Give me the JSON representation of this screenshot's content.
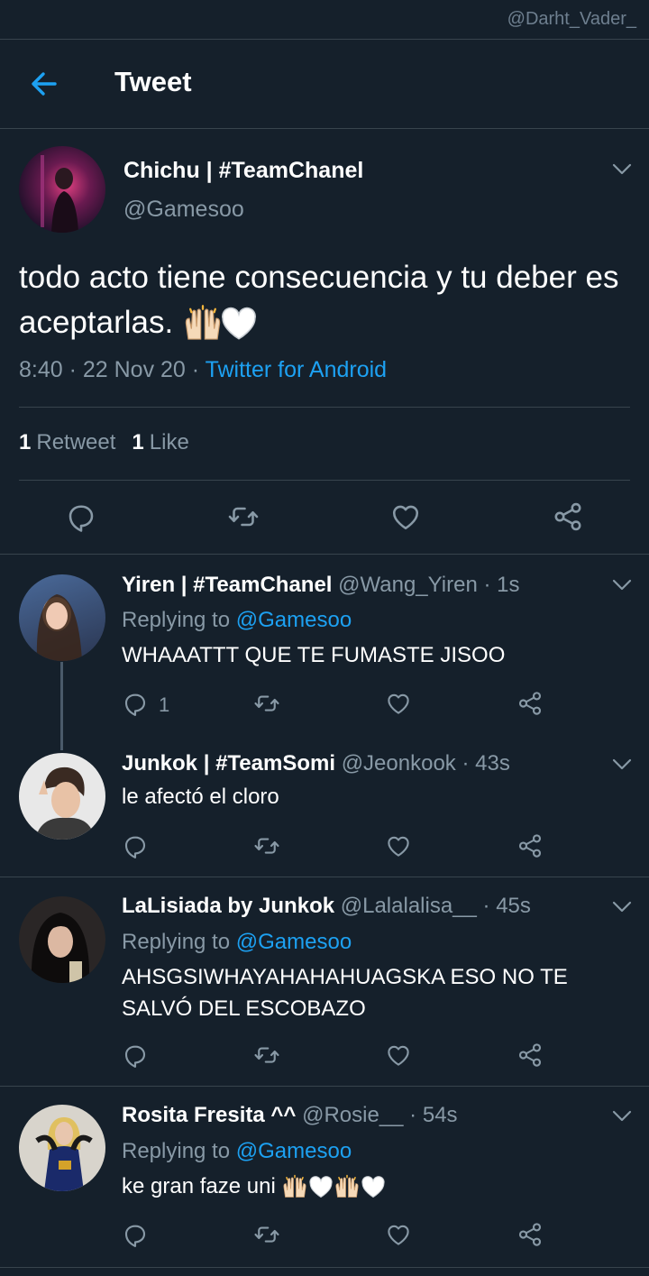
{
  "watermark": "@Darht_Vader_",
  "header": {
    "title": "Tweet",
    "back_icon": "arrow-left-icon"
  },
  "colors": {
    "background": "#15202b",
    "accent": "#1da1f2",
    "muted": "#8899a6",
    "divider": "#38444d"
  },
  "main_tweet": {
    "name": "Chichu | #TeamChanel",
    "handle": "@Gamesoo",
    "text": "todo acto tiene consecuencia y tu deber es aceptarlas.",
    "emojis": [
      "raising-hands",
      "white-heart"
    ],
    "time": "8:40 · 22 Nov 20 · ",
    "source": "Twitter for Android",
    "retweets_count": "1",
    "retweets_label": "Retweet",
    "likes_count": "1",
    "likes_label": "Like"
  },
  "replies": [
    {
      "name": "Yiren | #TeamChanel",
      "meta": "@Wang_Yiren · 1s",
      "replying_to": "Replying to ",
      "replying_handle": "@Gamesoo",
      "text": "WHAAATTT QUE TE FUMASTE JISOO",
      "reply_count": "1"
    },
    {
      "name": "Junkok | #TeamSomi",
      "meta": "@Jeonkook · 43s",
      "text": "le afectó el cloro"
    },
    {
      "name": "LaLisiada by Junkok",
      "meta": "@Lalalalisa__ · 45s",
      "replying_to": "Replying to ",
      "replying_handle": "@Gamesoo",
      "text": "AHSGSIWHAYAHAHAHUAGSKA ESO NO TE SALVÓ DEL ESCOBAZO"
    },
    {
      "name": "Rosita Fresita ^^",
      "meta": "@Rosie__ · 54s",
      "replying_to": "Replying to ",
      "replying_handle": "@Gamesoo",
      "text": "ke gran faze uni",
      "emojis": [
        "raising-hands",
        "white-heart",
        "raising-hands",
        "white-heart"
      ]
    }
  ]
}
